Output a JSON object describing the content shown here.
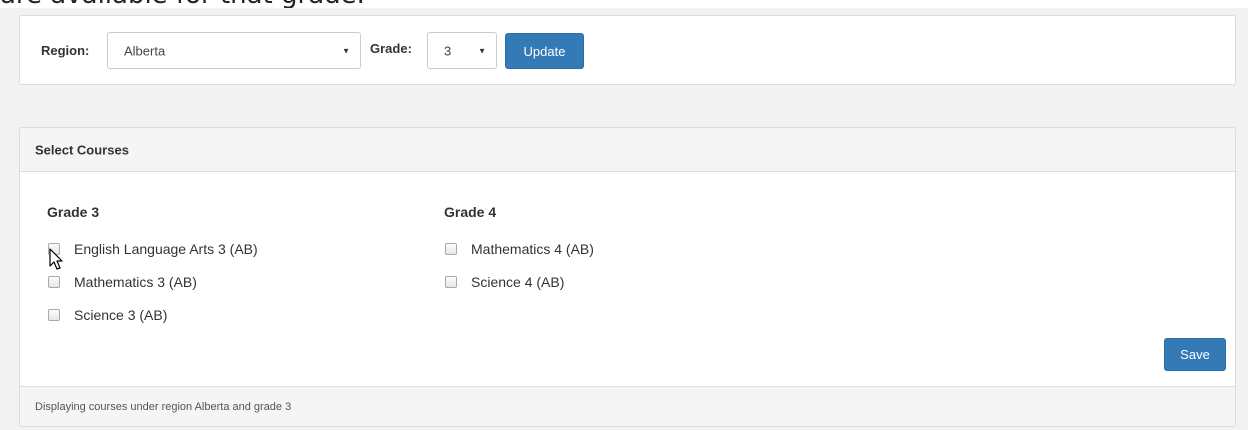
{
  "intro": {
    "text": "are available for that grade."
  },
  "filter": {
    "region_label": "Region:",
    "region_value": "Alberta",
    "grade_label": "Grade:",
    "grade_value": "3",
    "update_label": "Update"
  },
  "courses_panel": {
    "title": "Select Courses",
    "columns": [
      {
        "heading": "Grade 3",
        "courses": [
          {
            "label": "English Language Arts 3 (AB)",
            "checked": false
          },
          {
            "label": "Mathematics 3 (AB)",
            "checked": false
          },
          {
            "label": "Science 3 (AB)",
            "checked": false
          }
        ]
      },
      {
        "heading": "Grade 4",
        "courses": [
          {
            "label": "Mathematics 4 (AB)",
            "checked": false
          },
          {
            "label": "Science 4 (AB)",
            "checked": false
          }
        ]
      }
    ],
    "save_label": "Save",
    "footer_text": "Displaying courses under region Alberta and grade 3"
  },
  "icons": {
    "dropdown": "caret-down-icon",
    "pointer": "mouse-pointer-icon"
  },
  "colors": {
    "primary_button": "#337ab7",
    "panel_header": "#f5f5f5",
    "page_background": "#f2f2f2"
  }
}
